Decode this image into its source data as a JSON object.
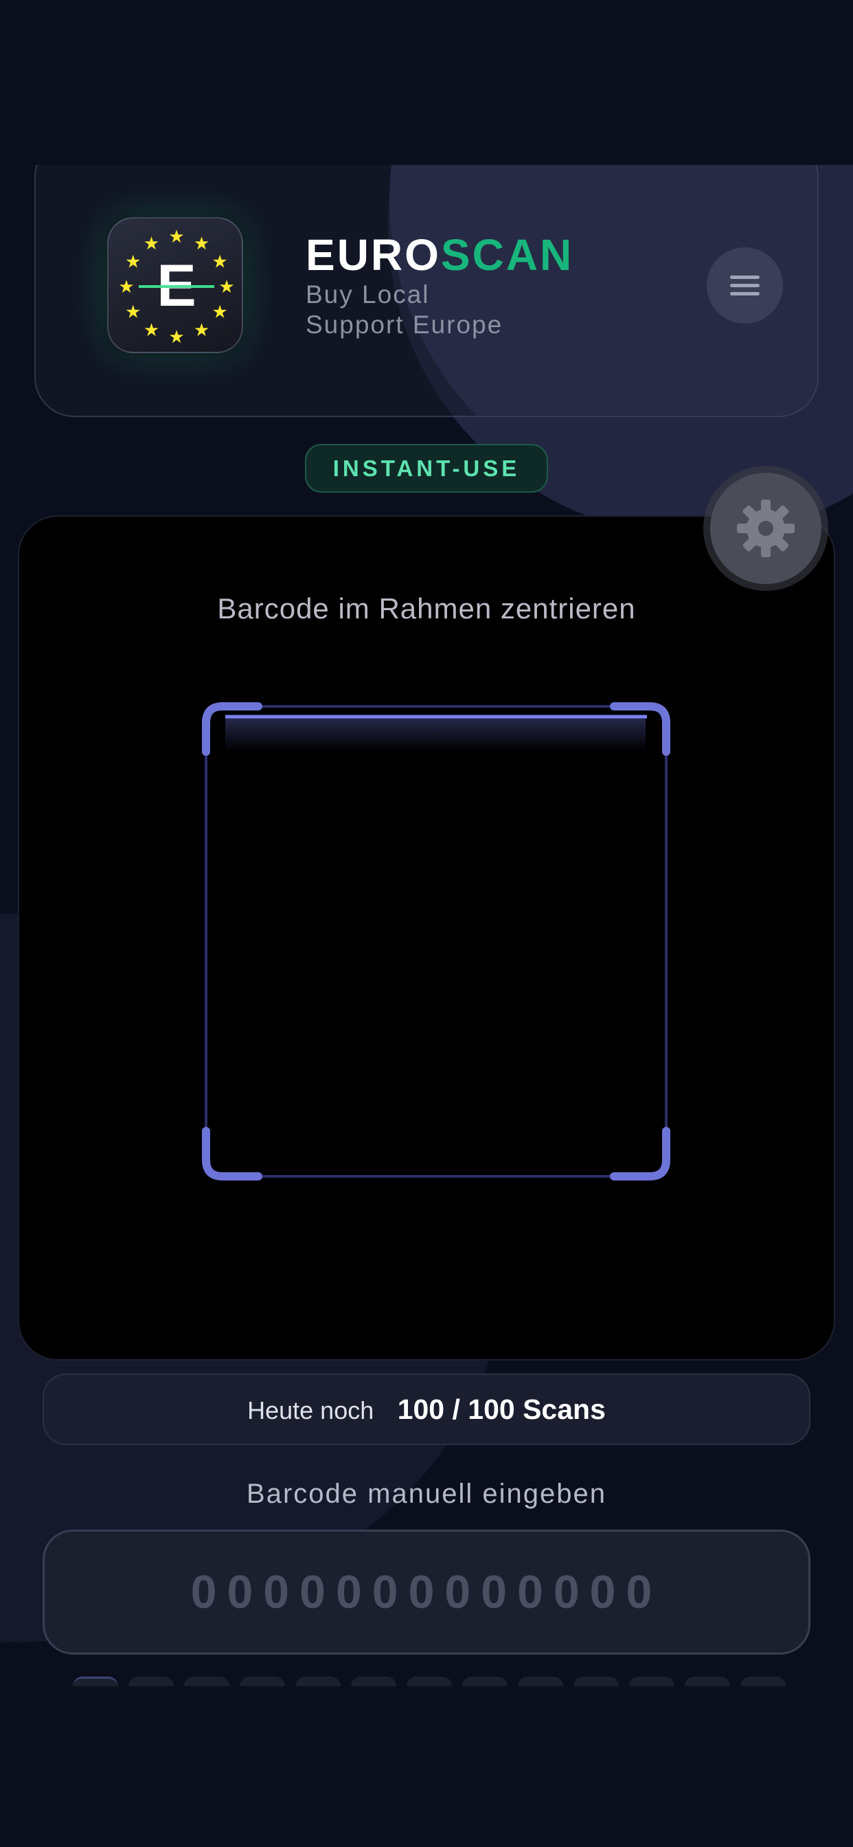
{
  "brand": {
    "name_part1": "EURO",
    "name_part2": "SCAN",
    "tagline_line1": "Buy Local",
    "tagline_line2": "Support Europe",
    "accent_color": "#18b67c",
    "logo_letter": "E"
  },
  "header": {
    "menu_icon": "hamburger-menu-icon"
  },
  "mode_badge": {
    "label": "INSTANT-USE"
  },
  "settings": {
    "icon": "gear-icon"
  },
  "scanner": {
    "hint": "Barcode im Rahmen zentrieren",
    "frame_color": "#6e75d9"
  },
  "quota": {
    "label": "Heute noch",
    "value": "100 / 100 Scans"
  },
  "manual_entry": {
    "label": "Barcode manuell eingeben",
    "placeholder": "0000000000000"
  }
}
